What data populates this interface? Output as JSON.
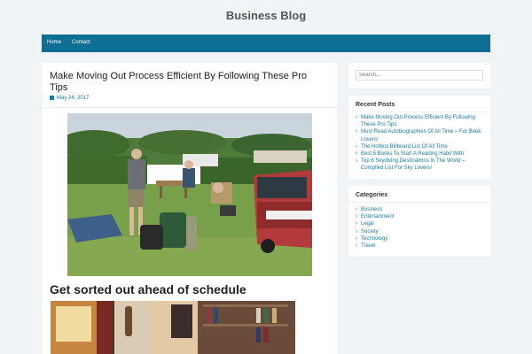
{
  "site": {
    "title": "Business Blog"
  },
  "nav": {
    "items": [
      "Home",
      "Contact"
    ]
  },
  "post": {
    "title": "Make Moving Out Process Efficient By Following These Pro Tips",
    "date": "May 24, 2017",
    "section_heading": "Get sorted out ahead of schedule"
  },
  "search": {
    "placeholder": "Search..."
  },
  "recent_posts": {
    "title": "Recent Posts",
    "items": [
      "Make Moving Out Process Efficient By Following These Pro Tips",
      "Must Read Autobiographies Of All Time – For Book Lovers!",
      "The Hottest Billboard List Of All Time",
      "Best 5 Books To Start A Reading Habit With",
      "Top 6 Skydiving Destinations In The World – Compiled List For Sky Lovers!"
    ]
  },
  "categories": {
    "title": "Categories",
    "items": [
      "Business",
      "Entertainment",
      "Legal",
      "Society",
      "Technology",
      "Travel"
    ]
  }
}
